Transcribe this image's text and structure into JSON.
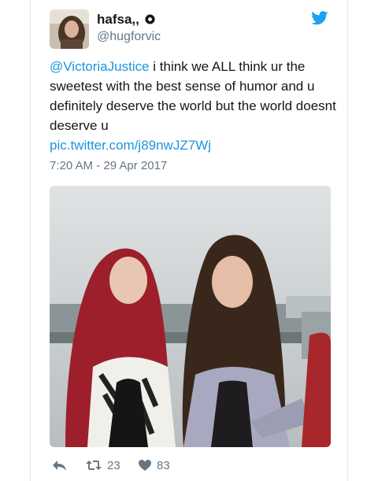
{
  "tweet": {
    "display_name": "hafsa,,",
    "handle": "@hugforvic",
    "mention": "@VictoriaJustice",
    "body": " i think we ALL think ur the sweetest with the best sense of humor and u definitely deserve the world but the world doesnt deserve u",
    "link": "pic.twitter.com/j89nwJZ7Wj",
    "timestamp": "7:20 AM - 29 Apr 2017"
  },
  "actions": {
    "retweets": "23",
    "likes": "83"
  },
  "colors": {
    "link": "#1b95e0",
    "text": "#14171a",
    "secondary": "#657786",
    "border": "#e1e8ed"
  },
  "icons": {
    "brand": "twitter-bird-icon",
    "verified": "badge-icon",
    "reply": "reply-icon",
    "retweet": "retweet-icon",
    "like": "heart-icon"
  }
}
